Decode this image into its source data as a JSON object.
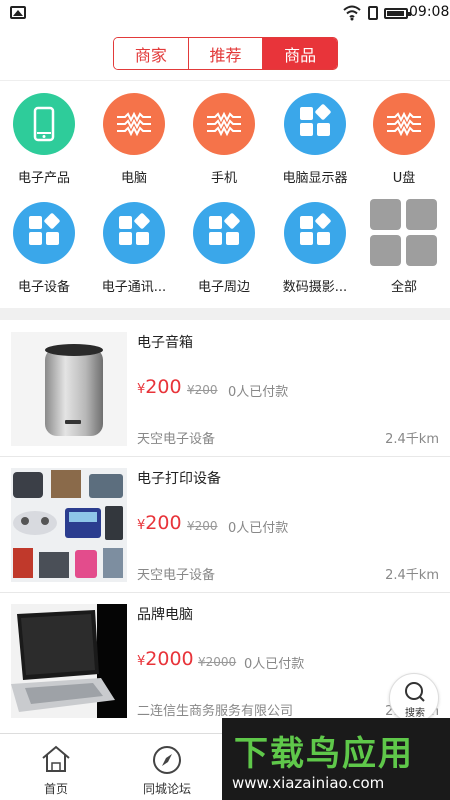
{
  "status_bar": {
    "time": "09:08"
  },
  "tabs": [
    {
      "label": "商家",
      "active": false
    },
    {
      "label": "推荐",
      "active": false
    },
    {
      "label": "商品",
      "active": true
    }
  ],
  "categories": [
    {
      "label": "电子产品",
      "icon": "phone-icon",
      "color": "#2ecc9a"
    },
    {
      "label": "电脑",
      "icon": "rhythm-icon",
      "color": "#f5734a"
    },
    {
      "label": "手机",
      "icon": "rhythm-icon",
      "color": "#f5734a"
    },
    {
      "label": "电脑显示器",
      "icon": "apps-icon",
      "color": "#3aa7ea"
    },
    {
      "label": "U盘",
      "icon": "rhythm-icon",
      "color": "#f5734a"
    },
    {
      "label": "电子设备",
      "icon": "apps-icon",
      "color": "#3aa7ea"
    },
    {
      "label": "电子通讯...",
      "icon": "apps-icon",
      "color": "#3aa7ea"
    },
    {
      "label": "电子周边",
      "icon": "apps-icon",
      "color": "#3aa7ea"
    },
    {
      "label": "数码摄影...",
      "icon": "apps-icon",
      "color": "#3aa7ea"
    },
    {
      "label": "全部",
      "icon": "grid-icon",
      "color": "#9e9e9e"
    }
  ],
  "products": [
    {
      "name": "电子音箱",
      "currency": "¥",
      "price": "200",
      "old_price": "¥200",
      "paid": "0人已付款",
      "shop": "天空电子设备",
      "distance": "2.4千km"
    },
    {
      "name": "电子打印设备",
      "currency": "¥",
      "price": "200",
      "old_price": "¥200",
      "paid": "0人已付款",
      "shop": "天空电子设备",
      "distance": "2.4千km"
    },
    {
      "name": "品牌电脑",
      "currency": "¥",
      "price": "2000",
      "old_price": "¥2000",
      "paid": "0人已付款",
      "shop": "二连信生商务服务有限公司",
      "distance": "2.4千km"
    }
  ],
  "fab": {
    "label": "搜索"
  },
  "bottom_nav": [
    {
      "label": "首页"
    },
    {
      "label": "同城论坛"
    }
  ],
  "watermark": {
    "title": "下载鸟应用",
    "url": "www.xiazainiao.com"
  },
  "colors": {
    "accent": "#e8343a",
    "green": "#2ecc9a",
    "orange": "#f5734a",
    "blue": "#3aa7ea"
  }
}
